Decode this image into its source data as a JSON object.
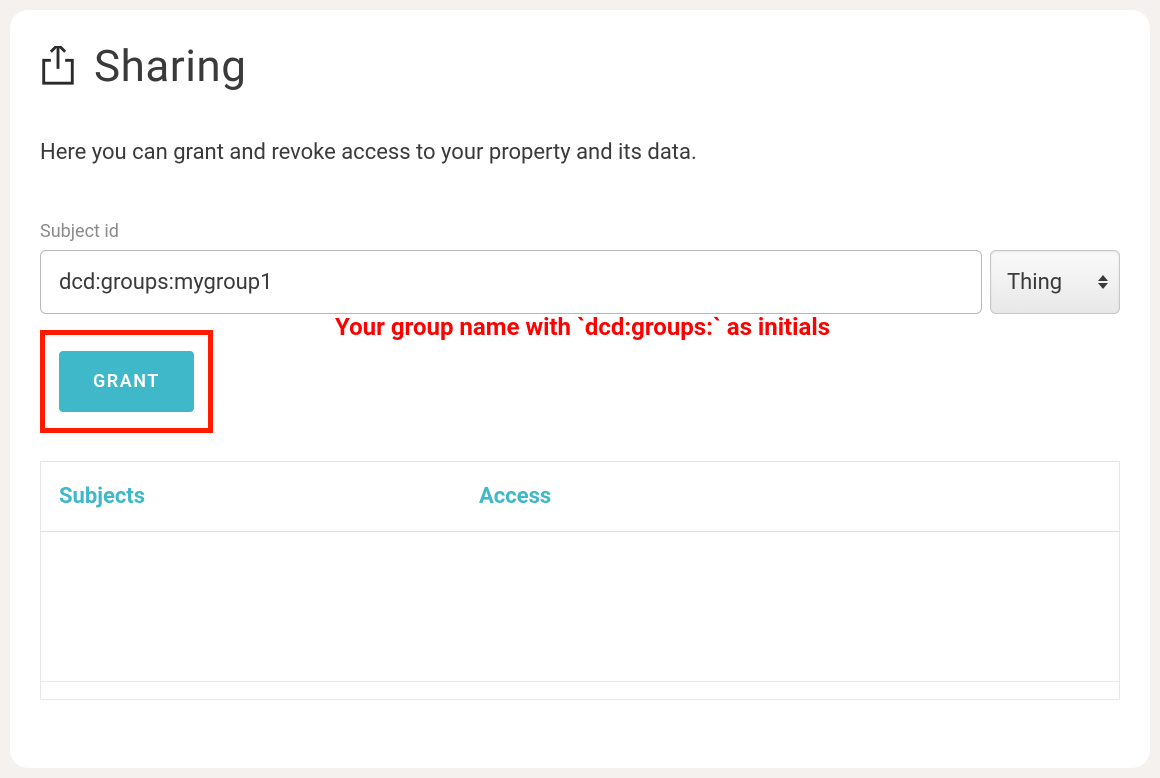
{
  "header": {
    "title": "Sharing"
  },
  "description": "Here you can grant and revoke access to your property and its data.",
  "form": {
    "subject_label": "Subject id",
    "subject_value": "dcd:groups:mygroup1",
    "type_selected": "Thing",
    "grant_label": "GRANT"
  },
  "annotation": "Your group name with `dcd:groups:` as initials",
  "table": {
    "col_subjects": "Subjects",
    "col_access": "Access"
  }
}
